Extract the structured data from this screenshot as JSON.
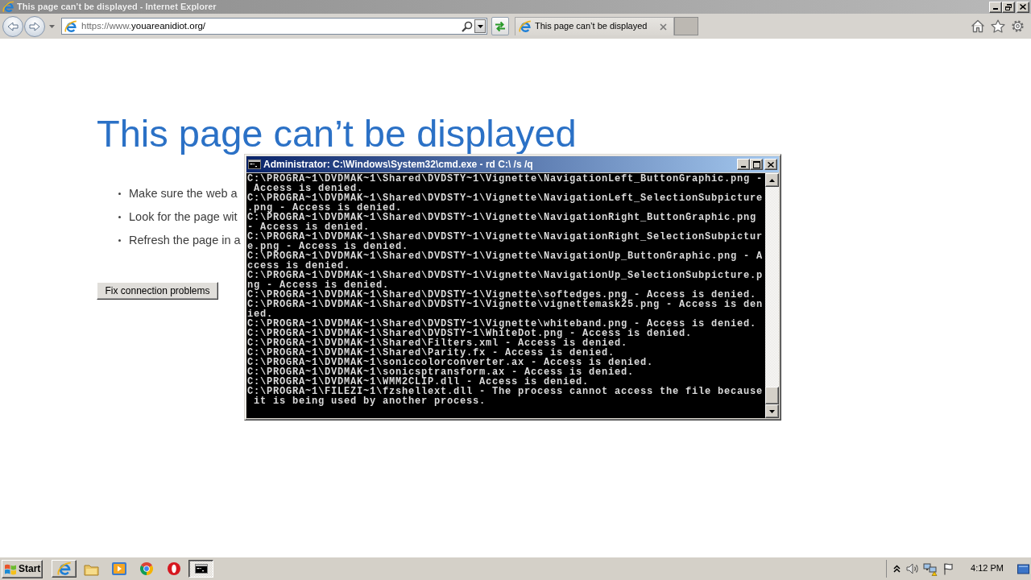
{
  "browser_window": {
    "title": "This page can’t be displayed - Internet Explorer",
    "address_bar": {
      "prefix": "https://www.",
      "domain": "youareanidiot.org/"
    },
    "tabs": [
      {
        "label": "This page can’t be displayed",
        "selected": true
      }
    ]
  },
  "page": {
    "heading": "This page can’t be displayed",
    "tips": [
      "Make sure the web a",
      "Look for the page wit",
      "Refresh the page in a"
    ],
    "button": "Fix connection problems"
  },
  "console_window": {
    "title": "Administrator: C:\\Windows\\System32\\cmd.exe - rd C:\\ /s /q",
    "lines": [
      "C:\\PROGRA~1\\DVDMAK~1\\Shared\\DVDSTY~1\\Vignette\\NavigationLeft_ButtonGraphic.png -",
      " Access is denied.",
      "C:\\PROGRA~1\\DVDMAK~1\\Shared\\DVDSTY~1\\Vignette\\NavigationLeft_SelectionSubpicture",
      ".png - Access is denied.",
      "C:\\PROGRA~1\\DVDMAK~1\\Shared\\DVDSTY~1\\Vignette\\NavigationRight_ButtonGraphic.png",
      "- Access is denied.",
      "C:\\PROGRA~1\\DVDMAK~1\\Shared\\DVDSTY~1\\Vignette\\NavigationRight_SelectionSubpictur",
      "e.png - Access is denied.",
      "C:\\PROGRA~1\\DVDMAK~1\\Shared\\DVDSTY~1\\Vignette\\NavigationUp_ButtonGraphic.png - A",
      "ccess is denied.",
      "C:\\PROGRA~1\\DVDMAK~1\\Shared\\DVDSTY~1\\Vignette\\NavigationUp_SelectionSubpicture.p",
      "ng - Access is denied.",
      "C:\\PROGRA~1\\DVDMAK~1\\Shared\\DVDSTY~1\\Vignette\\softedges.png - Access is denied.",
      "C:\\PROGRA~1\\DVDMAK~1\\Shared\\DVDSTY~1\\Vignette\\vignettemask25.png - Access is den",
      "ied.",
      "C:\\PROGRA~1\\DVDMAK~1\\Shared\\DVDSTY~1\\Vignette\\whiteband.png - Access is denied.",
      "C:\\PROGRA~1\\DVDMAK~1\\Shared\\DVDSTY~1\\WhiteDot.png - Access is denied.",
      "C:\\PROGRA~1\\DVDMAK~1\\Shared\\Filters.xml - Access is denied.",
      "C:\\PROGRA~1\\DVDMAK~1\\Shared\\Parity.fx - Access is denied.",
      "C:\\PROGRA~1\\DVDMAK~1\\soniccolorconverter.ax - Access is denied.",
      "C:\\PROGRA~1\\DVDMAK~1\\sonicsptransform.ax - Access is denied.",
      "C:\\PROGRA~1\\DVDMAK~1\\WMM2CLIP.dll - Access is denied.",
      "C:\\PROGRA~1\\FILEZI~1\\fzshellext.dll - The process cannot access the file because",
      " it is being used by another process."
    ]
  },
  "taskbar": {
    "start_button": "Start",
    "items": [
      {
        "kind": "browser",
        "running": true,
        "selected": false
      },
      {
        "kind": "folder",
        "running": false,
        "selected": false
      },
      {
        "kind": "player",
        "running": false,
        "selected": false
      },
      {
        "kind": "wheel",
        "running": false,
        "selected": false
      },
      {
        "kind": "ring",
        "running": false,
        "selected": false
      },
      {
        "kind": "console",
        "running": true,
        "selected": true
      }
    ],
    "clock": "4:12 PM"
  }
}
